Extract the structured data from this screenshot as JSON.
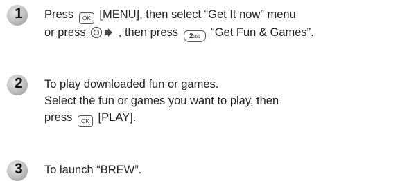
{
  "steps": [
    {
      "number": "1",
      "line1": {
        "press": "Press",
        "key_ok": "OK",
        "menu": "[MENU], then select “Get It now” menu"
      },
      "line2": {
        "or_press": "or press",
        "then_press": ", then press",
        "key_2": "2",
        "key_2_sub": "abc",
        "get_fun": "“Get Fun & Games”."
      }
    },
    {
      "number": "2",
      "line1": "To play downloaded fun or games.",
      "line2": "Select the fun or games you want to play, then",
      "line3": {
        "press": "press",
        "key_ok": "OK",
        "play": "[PLAY]."
      }
    },
    {
      "number": "3",
      "line1": "To launch “BREW”."
    }
  ],
  "icons": {
    "badge": "step-number-badge",
    "ok_key": "ok-key-icon",
    "nav_key": "navigation-key-right-icon",
    "two_key": "two-abc-key-icon"
  },
  "colors": {
    "badge_gradient_light": "#e9e9e9",
    "badge_gradient_dark": "#8f8f8f",
    "text": "#222222"
  }
}
